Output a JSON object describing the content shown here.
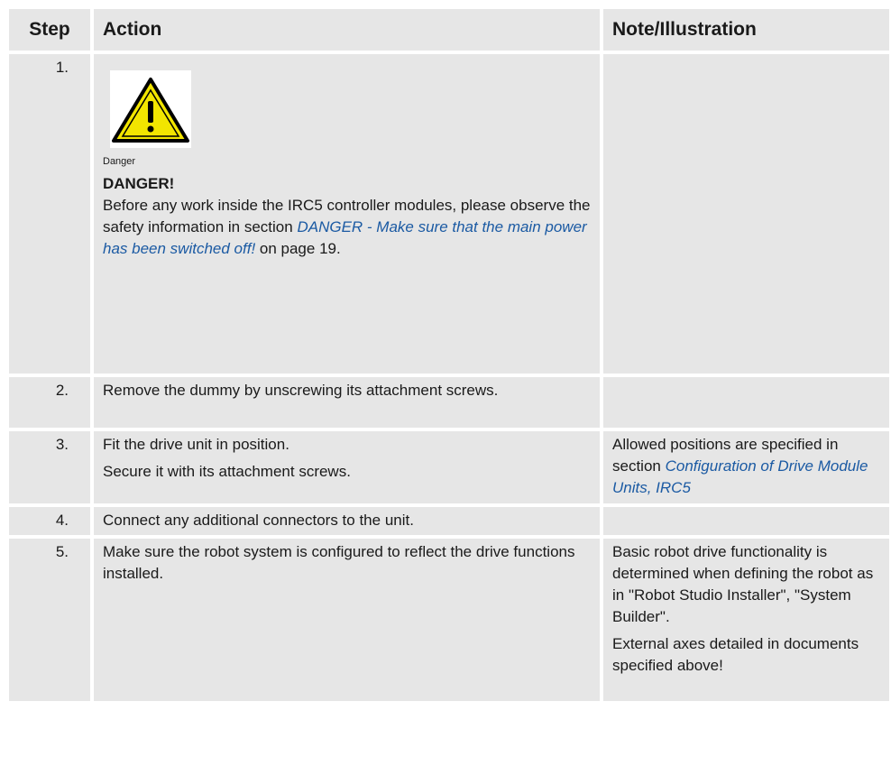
{
  "headers": {
    "step": "Step",
    "action": "Action",
    "note": "Note/Illustration"
  },
  "rows": [
    {
      "step": "1.",
      "icon": "warning-triangle-icon",
      "danger_caption": "Danger",
      "danger_title": "DANGER!",
      "text_before": "Before any work inside the IRC5 controller modules, please observe the safety information in section ",
      "link": "DANGER - Make sure that the main power has been switched off!",
      "text_after": " on page 19."
    },
    {
      "step": "2.",
      "action": "Remove the dummy by unscrewing its attachment screws."
    },
    {
      "step": "3.",
      "action_1": "Fit the drive unit in position.",
      "action_2": "Secure it with its attachment screws.",
      "note_text": "Allowed positions are specified in section ",
      "note_link": "Configuration of Drive Module Units, IRC5"
    },
    {
      "step": "4.",
      "action": "Connect any additional connectors to the unit."
    },
    {
      "step": "5.",
      "action": "Make sure the robot system is configured to reflect the drive functions installed.",
      "note_1": "Basic robot drive functionality is determined when defining the robot as in \"Robot Studio Installer\", \"System Builder\".",
      "note_2": "External axes detailed in documents specified above!"
    }
  ],
  "colors": {
    "cell_bg": "#e6e6e6",
    "link": "#1b5aa3",
    "warning_yellow": "#f2e500"
  }
}
